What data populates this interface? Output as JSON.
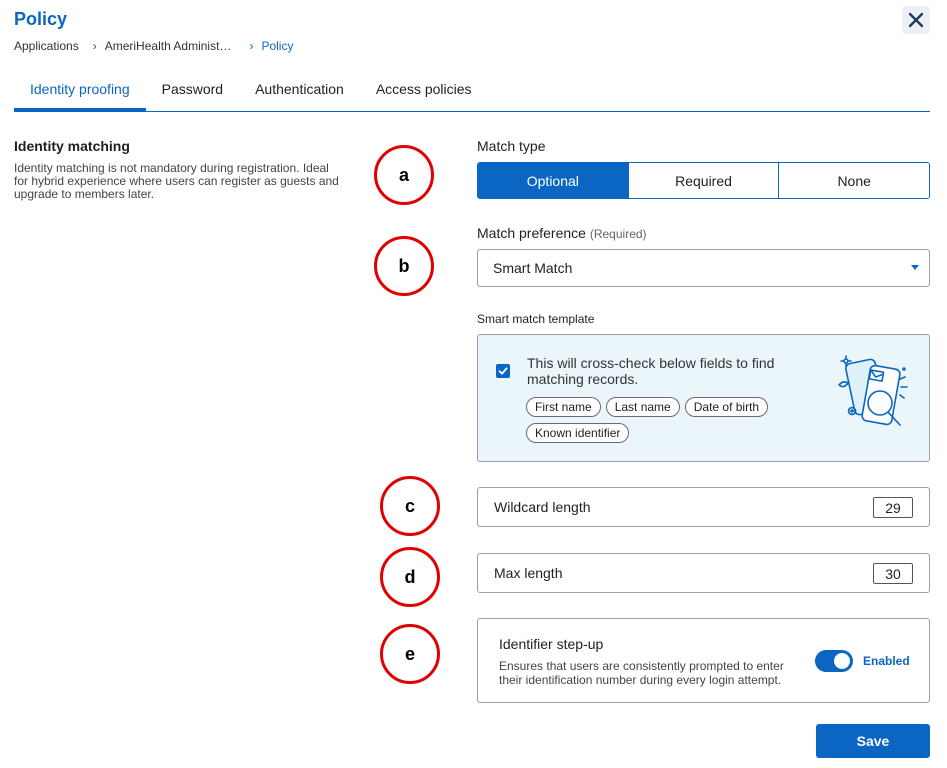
{
  "header": {
    "title": "Policy",
    "close_icon": "close-icon"
  },
  "breadcrumb": {
    "items": [
      "Applications",
      "AmeriHealth Administ…",
      "Policy"
    ]
  },
  "tabs": [
    {
      "label": "Identity proofing",
      "active": true
    },
    {
      "label": "Password",
      "active": false
    },
    {
      "label": "Authentication",
      "active": false
    },
    {
      "label": "Access policies",
      "active": false
    }
  ],
  "section": {
    "title": "Identity matching",
    "description": "Identity matching is not mandatory during registration. Ideal for hybrid experience where users can register as guests and upgrade to members later."
  },
  "annotations": [
    "a",
    "b",
    "c",
    "d",
    "e"
  ],
  "match_type": {
    "label": "Match type",
    "options": [
      "Optional",
      "Required",
      "None"
    ],
    "selected": "Optional"
  },
  "match_preference": {
    "label": "Match preference",
    "required_hint": "(Required)",
    "value": "Smart Match"
  },
  "smart_match": {
    "label": "Smart match template",
    "checked": true,
    "text": "This will cross-check below fields to find matching records.",
    "fields": [
      "First name",
      "Last name",
      "Date of birth",
      "Known identifier"
    ]
  },
  "wildcard": {
    "label": "Wildcard length",
    "value": "29"
  },
  "max_length": {
    "label": "Max length",
    "value": "30"
  },
  "stepup": {
    "title": "Identifier step-up",
    "description": "Ensures that users are consistently prompted to enter their identification number during every login attempt.",
    "toggle_on": true,
    "toggle_label": "Enabled"
  },
  "footer": {
    "save_label": "Save"
  },
  "colors": {
    "accent": "#0a66c2",
    "annotation_ring": "#e00000",
    "template_bg": "#eaf6fa"
  }
}
